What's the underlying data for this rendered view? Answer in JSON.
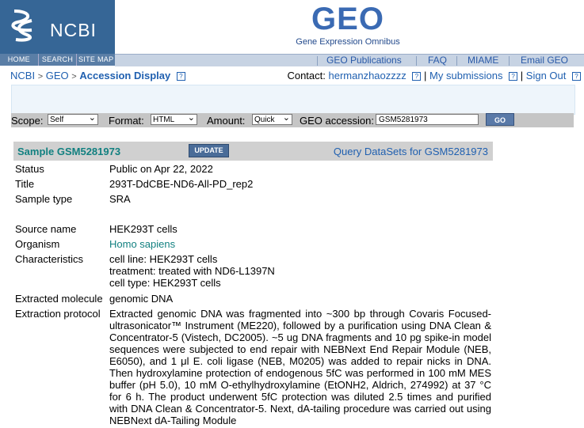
{
  "ncbi": {
    "logo_text": "NCBI",
    "nav": [
      "HOME",
      "SEARCH",
      "SITE MAP"
    ]
  },
  "geo": {
    "logo_text": "GEO",
    "subtitle": "Gene Expression Omnibus"
  },
  "toplinks": [
    "GEO Publications",
    "FAQ",
    "MIAME",
    "Email GEO"
  ],
  "breadcrumb": {
    "ncbi": "NCBI",
    "geo": "GEO",
    "current": "Accession Display",
    "sep": ">"
  },
  "help_icon": "?",
  "contact": {
    "label": "Contact:",
    "user": "hermanzhaozzzz",
    "my_submissions": "My submissions",
    "sign_out": "Sign Out",
    "pipe": "|"
  },
  "query": {
    "scope_label": "Scope:",
    "scope_value": "Self",
    "format_label": "Format:",
    "format_value": "HTML",
    "amount_label": "Amount:",
    "amount_value": "Quick",
    "accession_label": "GEO accession:",
    "accession_value": "GSM5281973",
    "go_label": "GO"
  },
  "sample": {
    "title": "Sample GSM5281973",
    "update_label": "UPDATE",
    "query_datasets": "Query DataSets for GSM5281973"
  },
  "fields": {
    "status": {
      "k": "Status",
      "v": "Public on Apr 22, 2022"
    },
    "title": {
      "k": "Title",
      "v": "293T-DdCBE-ND6-All-PD_rep2"
    },
    "sample_type": {
      "k": "Sample type",
      "v": "SRA"
    },
    "source_name": {
      "k": "Source name",
      "v": "HEK293T cells"
    },
    "organism": {
      "k": "Organism",
      "v": "Homo sapiens"
    },
    "characteristics": {
      "k": "Characteristics",
      "v1": "cell line: HEK293T cells",
      "v2": "treatment: treated with ND6-L1397N",
      "v3": "cell type: HEK293T cells"
    },
    "extracted_molecule": {
      "k": "Extracted molecule",
      "v": "genomic DNA"
    },
    "extraction_protocol": {
      "k": "Extraction protocol",
      "v": "Extracted genomic DNA was fragmented into ~300 bp through Covaris Focused-ultrasonicator™ Instrument (ME220), followed by a purification using DNA Clean & Concentrator-5 (Vistech, DC2005). ~5 ug DNA fragments and 10 pg spike-in model sequences were subjected to end repair with NEBNext End Repair Module (NEB, E6050), and 1 μl E. coli ligase (NEB, M0205) was added to repair nicks in DNA. Then hydroxylamine protection of endogenous 5fC was performed in 100 mM MES buffer (pH 5.0), 10 mM O-ethylhydroxylamine (EtONH2, Aldrich, 274992) at 37 °C for 6 h. The product underwent 5fC protection was diluted 2.5 times and purified with DNA Clean & Concentrator-5. Next, dA-tailing procedure was carried out using NEBNext dA-Tailing Module"
    }
  }
}
